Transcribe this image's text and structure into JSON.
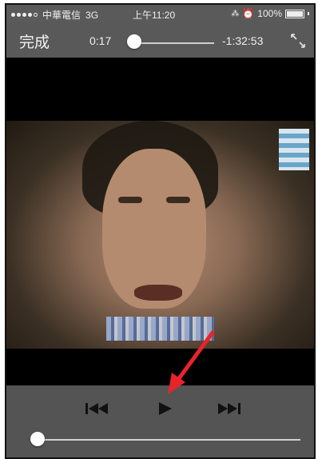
{
  "status_bar": {
    "carrier": "中華電信",
    "network": "3G",
    "time": "上午11:20",
    "battery": "100%"
  },
  "top_bar": {
    "done_label": "完成",
    "elapsed": "0:17",
    "remaining": "-1:32:53",
    "progress_fraction": 0.003
  },
  "controls": {
    "prev_label": "previous-track",
    "play_label": "play",
    "next_label": "next-track",
    "volume_fraction": 0.0
  },
  "colors": {
    "bar_bg": "#595959",
    "annotation_arrow": "#e8232a"
  }
}
